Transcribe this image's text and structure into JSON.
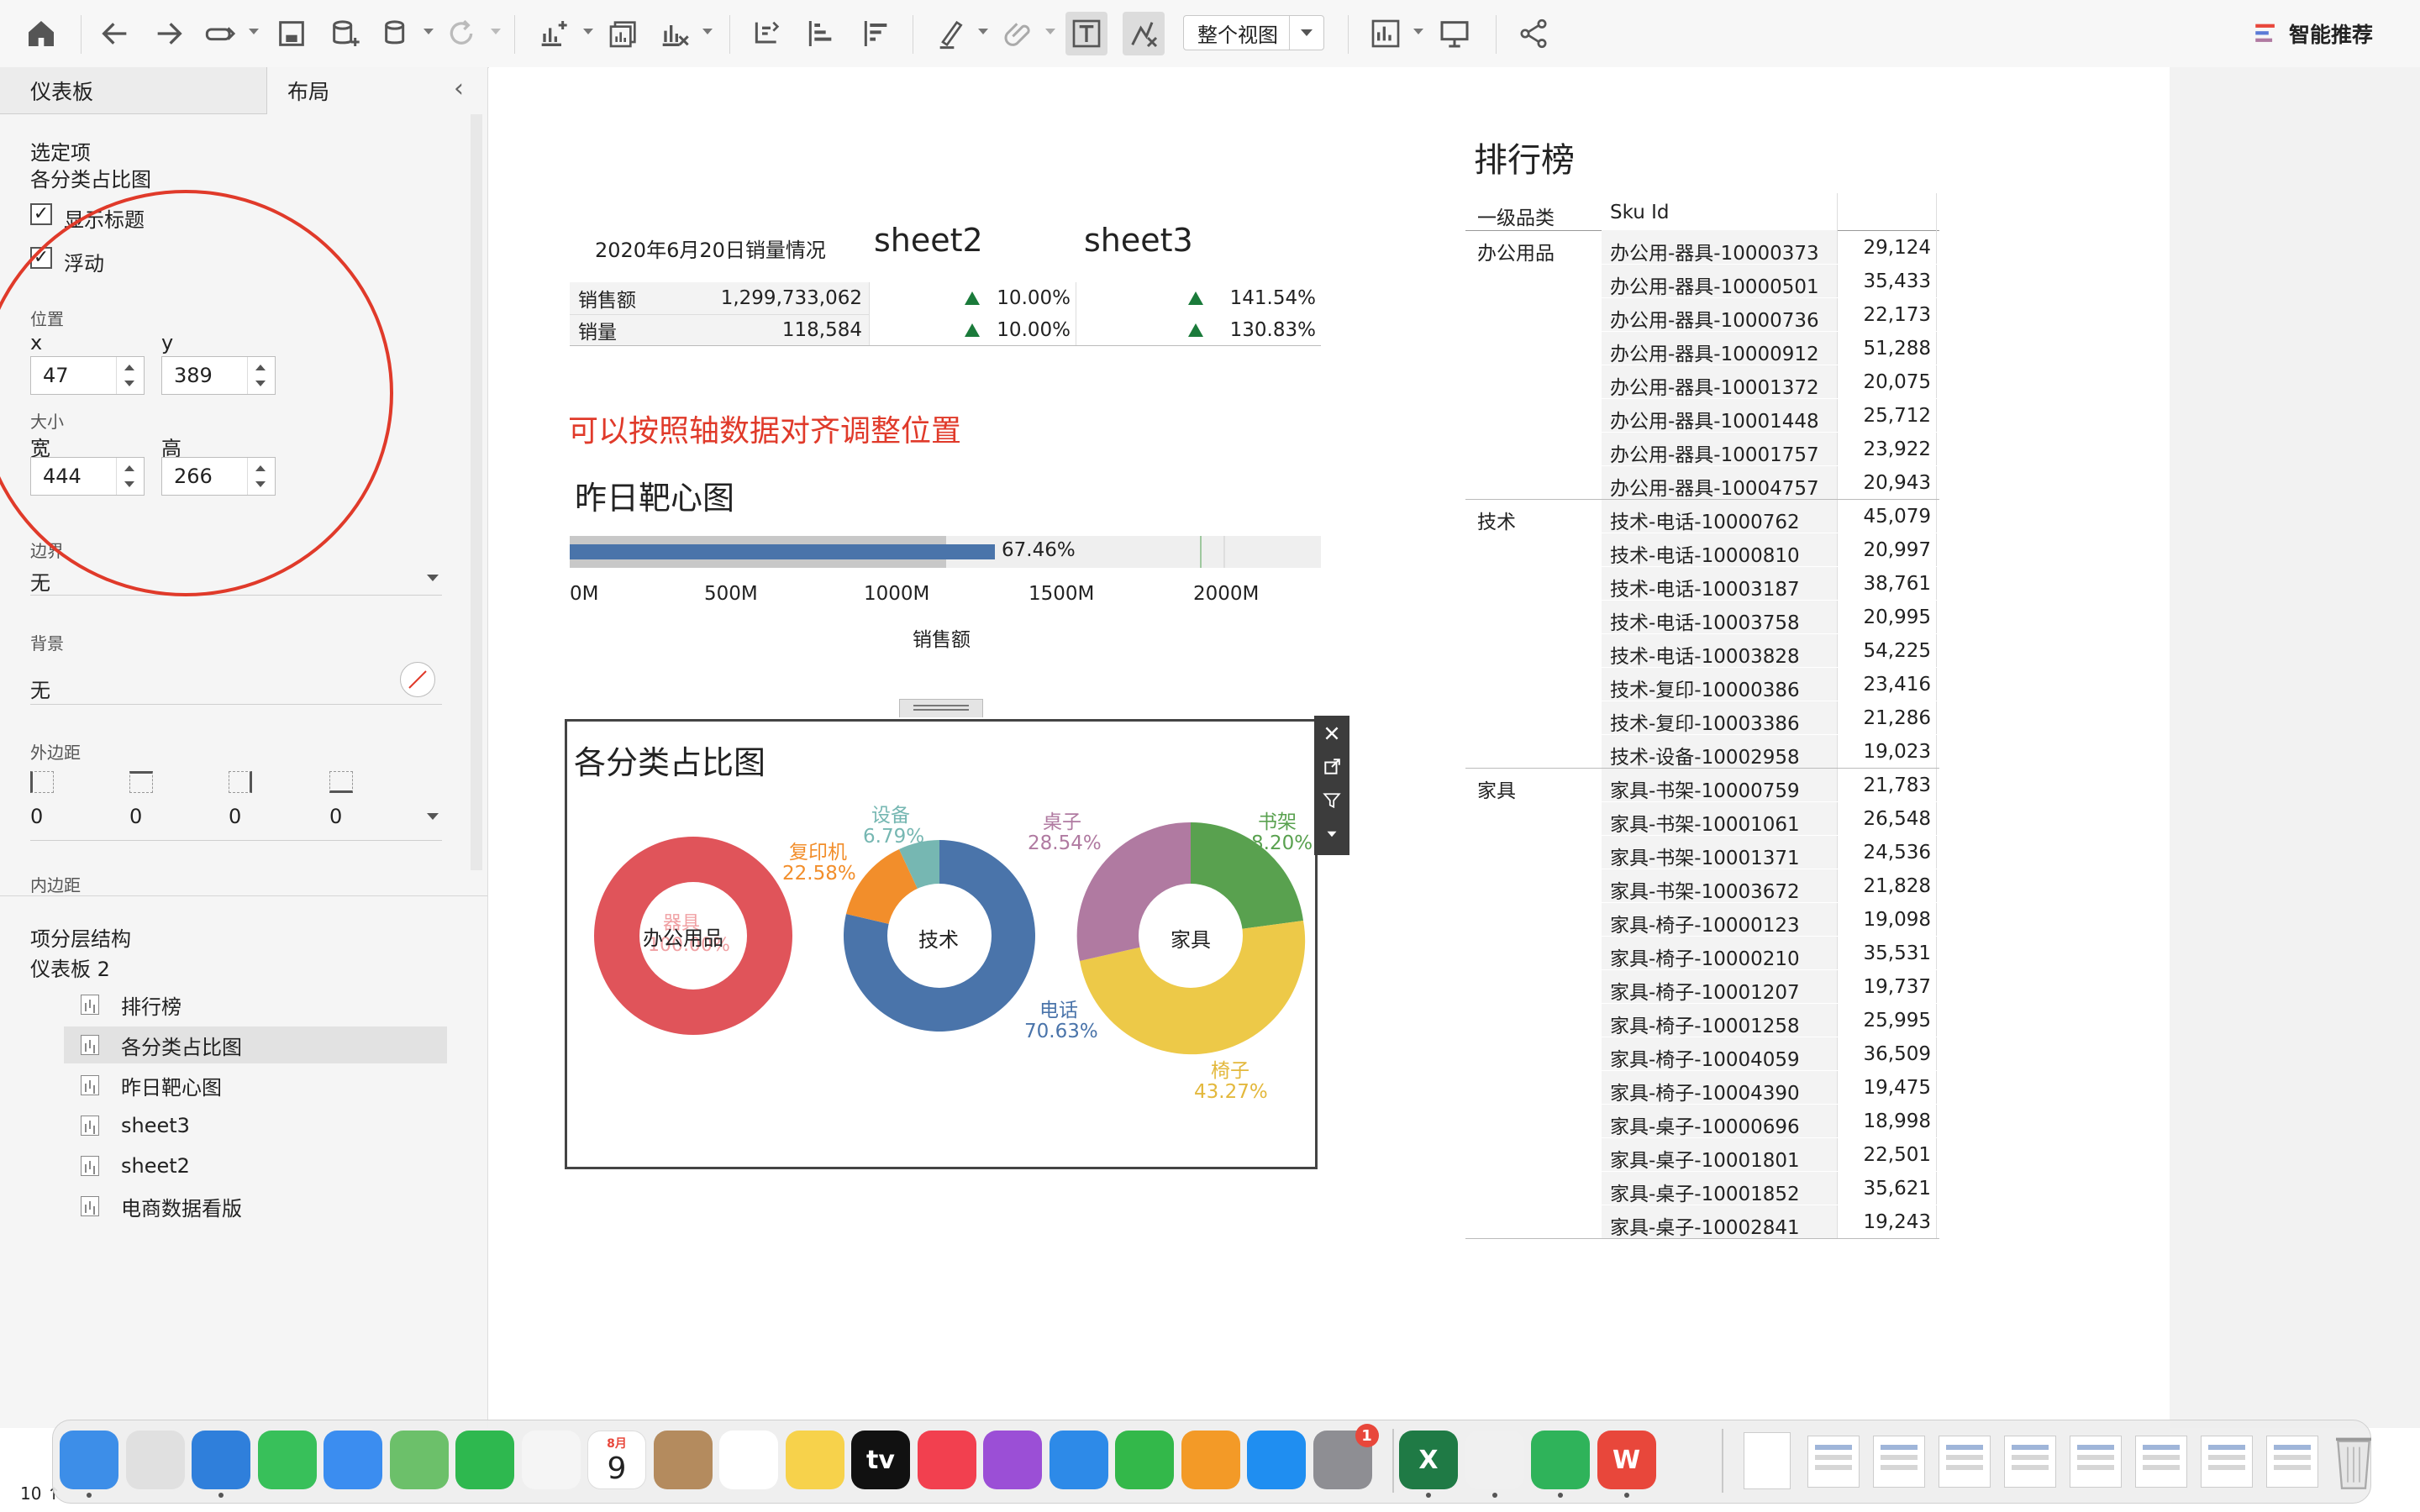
{
  "toolbar": {
    "view_mode": "整个视图",
    "smart_recommend": "智能推荐"
  },
  "left_panel": {
    "tabs": [
      "仪表板",
      "布局"
    ],
    "selected_item_header": "选定项",
    "selected_item_name": "各分类占比图",
    "show_title_label": "显示标题",
    "show_title_checked": true,
    "floating_label": "浮动",
    "floating_checked": true,
    "position_label": "位置",
    "x_label": "x",
    "y_label": "y",
    "x_value": "47",
    "y_value": "389",
    "size_label": "大小",
    "width_label": "宽",
    "height_label": "高",
    "width_value": "444",
    "height_value": "266",
    "border_label": "边界",
    "border_value": "无",
    "background_label": "背景",
    "background_value": "无",
    "outer_margin_label": "外边距",
    "outer_margin_values": [
      "0",
      "0",
      "0",
      "0"
    ],
    "inner_margin_label": "内边距",
    "hierarchy_label": "项分层结构",
    "dashboard_name": "仪表板 2",
    "tree_items": [
      "排行榜",
      "各分类占比图",
      "昨日靶心图",
      "sheet3",
      "sheet2",
      "电商数据看版"
    ],
    "selected_tree_index": 1,
    "status_fragment": "10 ↑"
  },
  "kpi": {
    "header": "2020年6月20日销量情况",
    "sheet2_title": "sheet2",
    "sheet3_title": "sheet3",
    "rows": [
      {
        "label": "销售额",
        "value": "1,299,733,062",
        "growth2": "10.00%",
        "growth3": "141.54%"
      },
      {
        "label": "销量",
        "value": "118,584",
        "growth2": "10.00%",
        "growth3": "130.83%"
      }
    ],
    "up_color": "#1a7a3a"
  },
  "annotation": {
    "text": "可以按照轴数据对齐调整位置",
    "color": "#e03a2a"
  },
  "bullet": {
    "title": "昨日靶心图",
    "percent_label": "67.46%",
    "axis_label": "销售额",
    "bar_color": "#4a74aa"
  },
  "pie": {
    "title": "各分类占比图",
    "donuts": [
      {
        "center": "办公用品",
        "slices": [
          {
            "name": "器具",
            "pct": "100.00%",
            "color": "#e0545a"
          }
        ]
      },
      {
        "center": "技术",
        "slices": [
          {
            "name": "电话",
            "pct": "70.63%",
            "color": "#4a74aa"
          },
          {
            "name": "复印机",
            "pct": "22.58%",
            "color": "#f28e2b"
          },
          {
            "name": "设备",
            "pct": "6.79%",
            "color": "#76b7b2"
          }
        ]
      },
      {
        "center": "家具",
        "slices": [
          {
            "name": "书架",
            "pct": "8.20%",
            "color": "#59a14f"
          },
          {
            "name": "椅子",
            "pct": "43.27%",
            "color": "#edc948"
          },
          {
            "name": "桌子",
            "pct": "28.54%",
            "color": "#b07aa1"
          }
        ]
      }
    ]
  },
  "ranking": {
    "title": "排行榜",
    "col_category": "一级品类",
    "col_sku": "Sku Id",
    "groups": [
      {
        "category": "办公用品",
        "rows": [
          [
            "办公用-器具-10000373",
            "29,124"
          ],
          [
            "办公用-器具-10000501",
            "35,433"
          ],
          [
            "办公用-器具-10000736",
            "22,173"
          ],
          [
            "办公用-器具-10000912",
            "51,288"
          ],
          [
            "办公用-器具-10001372",
            "20,075"
          ],
          [
            "办公用-器具-10001448",
            "25,712"
          ],
          [
            "办公用-器具-10001757",
            "23,922"
          ],
          [
            "办公用-器具-10004757",
            "20,943"
          ]
        ]
      },
      {
        "category": "技术",
        "rows": [
          [
            "技术-电话-10000762",
            "45,079"
          ],
          [
            "技术-电话-10000810",
            "20,997"
          ],
          [
            "技术-电话-10003187",
            "38,761"
          ],
          [
            "技术-电话-10003758",
            "20,995"
          ],
          [
            "技术-电话-10003828",
            "54,225"
          ],
          [
            "技术-复印-10000386",
            "23,416"
          ],
          [
            "技术-复印-10003386",
            "21,286"
          ],
          [
            "技术-设备-10002958",
            "19,023"
          ]
        ]
      },
      {
        "category": "家具",
        "rows": [
          [
            "家具-书架-10000759",
            "21,783"
          ],
          [
            "家具-书架-10001061",
            "26,548"
          ],
          [
            "家具-书架-10001371",
            "24,536"
          ],
          [
            "家具-书架-10003672",
            "21,828"
          ],
          [
            "家具-椅子-10000123",
            "19,098"
          ],
          [
            "家具-椅子-10000210",
            "35,531"
          ],
          [
            "家具-椅子-10001207",
            "19,737"
          ],
          [
            "家具-椅子-10001258",
            "25,995"
          ],
          [
            "家具-椅子-10004059",
            "36,509"
          ],
          [
            "家具-椅子-10004390",
            "19,475"
          ],
          [
            "家具-桌子-10000696",
            "18,998"
          ],
          [
            "家具-桌子-10001801",
            "22,501"
          ],
          [
            "家具-桌子-10001852",
            "35,621"
          ],
          [
            "家具-桌子-10002841",
            "19,243"
          ]
        ]
      }
    ]
  },
  "dock": {
    "calendar_month": "8月",
    "calendar_day": "9",
    "badge_count": "1",
    "apps": [
      {
        "icon": "finder-icon",
        "color": "#3d8ee8"
      },
      {
        "icon": "launchpad-icon",
        "color": "#e0e0e0"
      },
      {
        "icon": "safari-icon",
        "color": "#2f7fdb"
      },
      {
        "icon": "messages-icon",
        "color": "#38c05a"
      },
      {
        "icon": "mail-icon",
        "color": "#3b8df0"
      },
      {
        "icon": "maps-icon",
        "color": "#6cc06a"
      },
      {
        "icon": "facetime-icon",
        "color": "#2eb84f"
      },
      {
        "icon": "photos-icon",
        "color": "#f5f5f5"
      },
      {
        "icon": "calendar-icon",
        "color": "#ffffff"
      },
      {
        "icon": "contacts-icon",
        "color": "#b48b5e"
      },
      {
        "icon": "reminders-icon",
        "color": "#ffffff"
      },
      {
        "icon": "notes-icon",
        "color": "#f7d24b"
      },
      {
        "icon": "appletv-icon",
        "color": "#111111",
        "text": "tv"
      },
      {
        "icon": "music-icon",
        "color": "#f2404f"
      },
      {
        "icon": "podcasts-icon",
        "color": "#9b4fd6"
      },
      {
        "icon": "keynote-icon",
        "color": "#2d8ae8"
      },
      {
        "icon": "numbers-icon",
        "color": "#33b84a"
      },
      {
        "icon": "pages-icon",
        "color": "#f39a27"
      },
      {
        "icon": "appstore-icon",
        "color": "#1f8ef1"
      },
      {
        "icon": "system-settings-icon",
        "color": "#8e8e93"
      },
      {
        "icon": "excel-icon",
        "color": "#1f7a45",
        "text": "X"
      },
      {
        "icon": "tableau-icon",
        "color": "#f0f0f0"
      },
      {
        "icon": "media-player-icon",
        "color": "#2fb35a"
      },
      {
        "icon": "wps-icon",
        "color": "#e8473b",
        "text": "W"
      }
    ]
  }
}
